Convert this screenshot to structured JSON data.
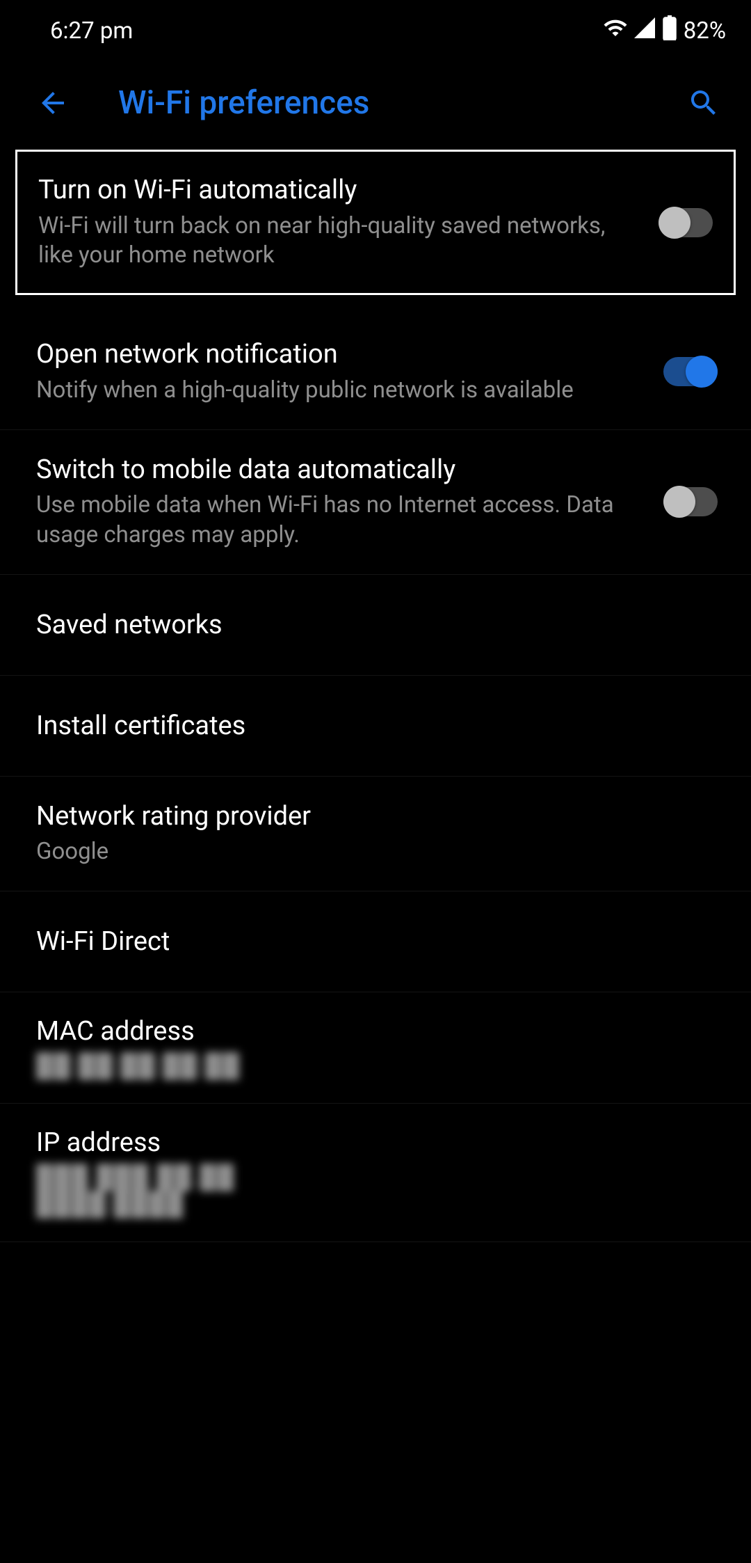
{
  "status_bar": {
    "time": "6:27 pm",
    "battery": "82%"
  },
  "header": {
    "title": "Wi-Fi preferences"
  },
  "items": {
    "auto_wifi": {
      "title": "Turn on Wi-Fi automatically",
      "subtitle": "Wi-Fi will turn back on near high-quality saved networks, like your home network",
      "state": "off"
    },
    "open_notify": {
      "title": "Open network notification",
      "subtitle": "Notify when a high-quality public network is available",
      "state": "on"
    },
    "mobile_data": {
      "title": "Switch to mobile data automatically",
      "subtitle": "Use mobile data when Wi-Fi has no Internet access. Data usage charges may apply.",
      "state": "off"
    },
    "saved_networks": {
      "title": "Saved networks"
    },
    "install_certs": {
      "title": "Install certificates"
    },
    "rating_provider": {
      "title": "Network rating provider",
      "subtitle": "Google"
    },
    "wifi_direct": {
      "title": "Wi-Fi Direct"
    },
    "mac_address": {
      "title": "MAC address",
      "value": "██:██:██:██:██"
    },
    "ip_address": {
      "title": "IP address",
      "value": "███.███.██.██\n████:████"
    }
  }
}
